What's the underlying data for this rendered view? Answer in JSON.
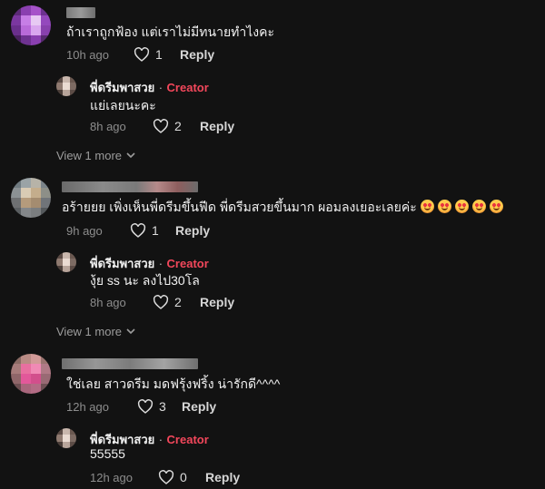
{
  "comments": [
    {
      "text": "ถ้าเราถูกฟ้อง แต่เราไม่มีทนายทำไงคะ",
      "time": "10h ago",
      "likes": "1",
      "reply_label": "Reply",
      "creator_reply": {
        "name": "พี่ดรีมพาสวย",
        "separator": "·",
        "badge": "Creator",
        "text": "แย่เลยนะคะ",
        "time": "8h ago",
        "likes": "2",
        "reply_label": "Reply"
      },
      "view_more": "View 1 more"
    },
    {
      "text": "อร้ายยย เพิ่งเห็นพี่ดรีมขึ้นฟีด พี่ดรีมสวยขึ้นมาก ผอมลงเยอะเลยค่ะ",
      "emoji_icon": "smiling-face-with-heart-eyes-icon",
      "time": "9h ago",
      "likes": "1",
      "reply_label": "Reply",
      "creator_reply": {
        "name": "พี่ดรีมพาสวย",
        "separator": "·",
        "badge": "Creator",
        "text": "งุ้ย ss นะ ลงไป30โล",
        "time": "8h ago",
        "likes": "2",
        "reply_label": "Reply"
      },
      "view_more": "View 1 more"
    },
    {
      "text": "ใช่เลย สาวดรีม มดฟรุ้งฟริ้ง น่ารักดี^^^^",
      "time": "12h ago",
      "likes": "3",
      "reply_label": "Reply",
      "creator_reply": {
        "name": "พี่ดรีมพาสวย",
        "separator": "·",
        "badge": "Creator",
        "text": "55555",
        "time": "12h ago",
        "likes": "0",
        "reply_label": "Reply"
      }
    }
  ],
  "colors": {
    "background": "#121212",
    "creator_badge": "#f2475b",
    "muted_text": "#8d8d8d"
  },
  "icons": {
    "like": "heart-outline-icon",
    "expand": "chevron-down-icon"
  }
}
